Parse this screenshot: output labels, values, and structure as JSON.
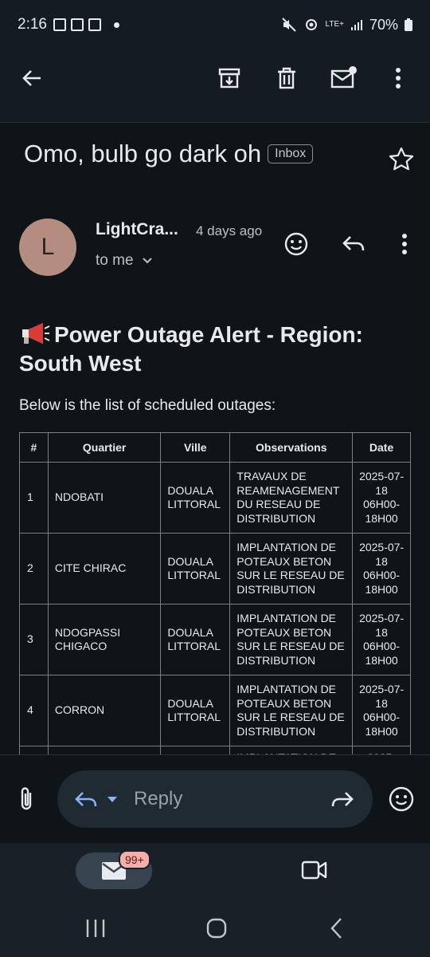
{
  "status_bar": {
    "time": "2:16",
    "battery": "70%",
    "network": "LTE+"
  },
  "email": {
    "subject": "Omo, bulb go dark oh",
    "label": "Inbox",
    "sender_name": "LightCra...",
    "sender_initial": "L",
    "time_ago": "4 days ago",
    "recipient": "to me",
    "body_title": "Power Outage Alert - Region: South West",
    "intro": "Below is the list of scheduled outages:",
    "table": {
      "headers": [
        "#",
        "Quartier",
        "Ville",
        "Observations",
        "Date"
      ],
      "rows": [
        [
          "1",
          "NDOBATI",
          "DOUALA LITTORAL",
          "TRAVAUX DE REAMENAGEMENT DU RESEAU DE DISTRIBUTION",
          "2025-07-18 06H00-18H00"
        ],
        [
          "2",
          "CITE CHIRAC",
          "DOUALA LITTORAL",
          "IMPLANTATION DE POTEAUX BETON SUR LE RESEAU DE DISTRIBUTION",
          "2025-07-18 06H00-18H00"
        ],
        [
          "3",
          "NDOGPASSI CHIGACO",
          "DOUALA LITTORAL",
          "IMPLANTATION DE POTEAUX BETON SUR LE RESEAU DE DISTRIBUTION",
          "2025-07-18 06H00-18H00"
        ],
        [
          "4",
          "CORRON",
          "DOUALA LITTORAL",
          "IMPLANTATION DE POTEAUX BETON SUR LE RESEAU DE DISTRIBUTION",
          "2025-07-18 06H00-18H00"
        ],
        [
          "",
          "",
          "",
          "IMPLANTATION DE",
          "2025-"
        ]
      ]
    }
  },
  "compose": {
    "reply_label": "Reply"
  },
  "nav": {
    "mail_badge": "99+"
  },
  "icons": {
    "back": "arrow-left-icon",
    "archive": "archive-icon",
    "delete": "trash-icon",
    "mark_unread": "mail-unread-icon",
    "more": "more-vert-icon",
    "star": "star-icon",
    "emoji": "emoji-icon",
    "reply": "reply-icon",
    "attach": "paperclip-icon",
    "forward": "forward-icon",
    "meet": "video-icon"
  }
}
